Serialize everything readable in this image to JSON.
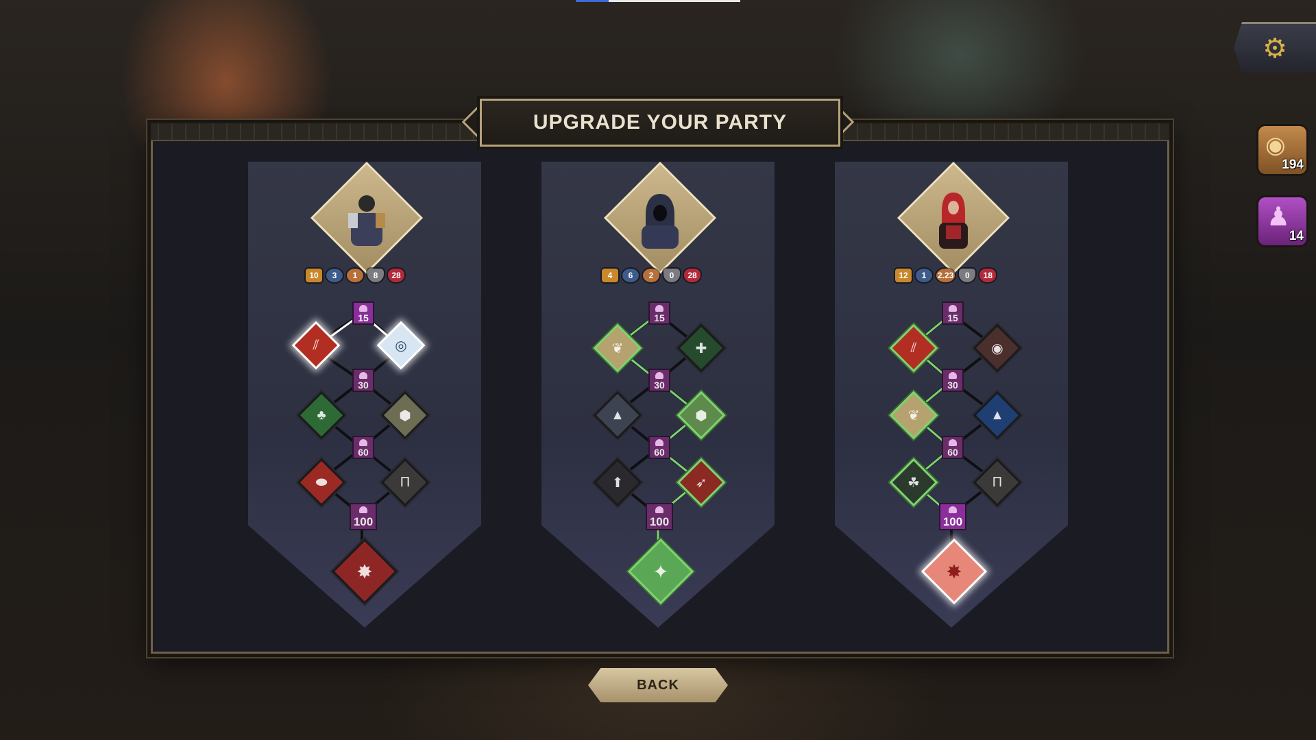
{
  "title": "UPGRADE YOUR PARTY",
  "back_label": "BACK",
  "resources": {
    "gold": "194",
    "trainers": "14"
  },
  "icons": {
    "settings": "gear-icon",
    "gold": "coin-stack-icon",
    "trainer": "muscle-figure-icon"
  },
  "colors": {
    "frame_gold": "#b6a27b",
    "selected_green": "#7ed36f",
    "trainer_purple": "#8a2f9a"
  },
  "tier_levels": [
    "15",
    "30",
    "60",
    "100"
  ],
  "characters": [
    {
      "name_icon": "warrior-portrait",
      "stats": [
        "10",
        "3",
        "1",
        "8",
        "28"
      ],
      "tiers": [
        {
          "left_icon": "twin-blades-icon",
          "right_icon": "shield-eye-icon"
        },
        {
          "left_icon": "tree-icon",
          "right_icon": "turtle-shell-icon"
        },
        {
          "left_icon": "meat-icon",
          "right_icon": "pillar-icon"
        }
      ],
      "ultimate_icon": "burst-star-icon"
    },
    {
      "name_icon": "hooded-rogue-portrait",
      "stats": [
        "4",
        "6",
        "2",
        "0",
        "28"
      ],
      "tiers": [
        {
          "left_icon": "bird-claw-icon",
          "right_icon": "crossed-blades-icon"
        },
        {
          "left_icon": "wolf-head-icon",
          "right_icon": "turtle-shell-icon"
        },
        {
          "left_icon": "wolf-howl-icon",
          "right_icon": "bow-target-icon"
        }
      ],
      "ultimate_icon": "throwing-figure-icon"
    },
    {
      "name_icon": "red-haired-mage-portrait",
      "stats": [
        "12",
        "1",
        "2.23",
        "0",
        "18"
      ],
      "tiers": [
        {
          "left_icon": "twin-blades-icon",
          "right_icon": "spiral-icon"
        },
        {
          "left_icon": "bird-claw-icon",
          "right_icon": "wolf-head-icon"
        },
        {
          "left_icon": "triquetra-icon",
          "right_icon": "pillar-icon"
        }
      ],
      "ultimate_icon": "burst-star-icon"
    }
  ]
}
